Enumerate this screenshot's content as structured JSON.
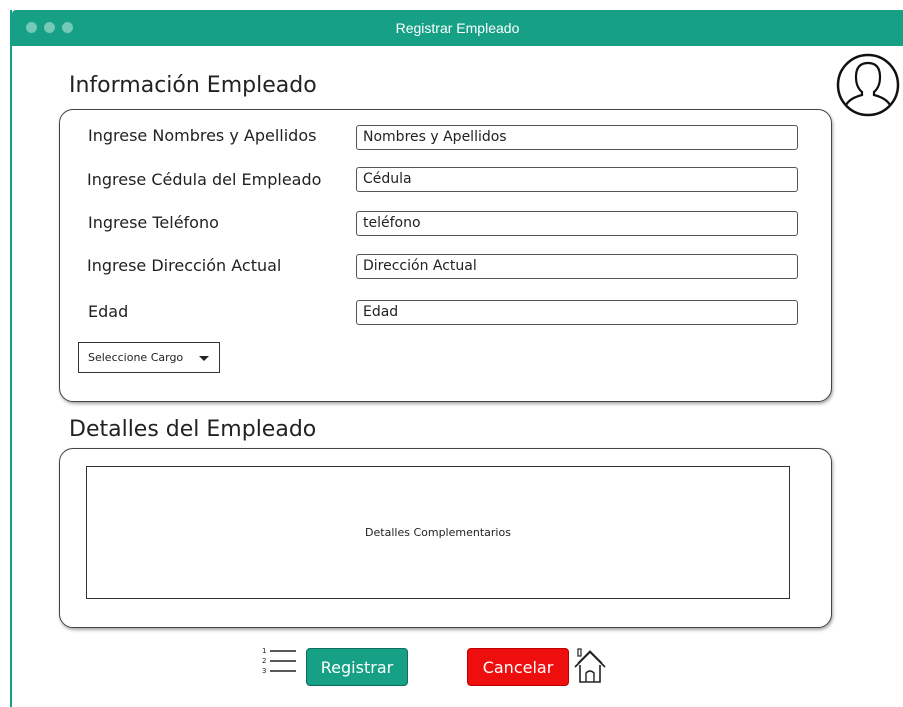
{
  "window": {
    "title": "Registrar Empleado"
  },
  "info_section": {
    "title": "Información Empleado",
    "fields": [
      {
        "label": "Ingrese Nombres y Apellidos",
        "value": "Nombres y Apellidos"
      },
      {
        "label": "Ingrese Cédula del Empleado",
        "value": "Cédula"
      },
      {
        "label": "Ingrese Teléfono",
        "value": "teléfono"
      },
      {
        "label": "Ingrese Dirección Actual",
        "value": "Dirección Actual"
      },
      {
        "label": "Edad",
        "value": "Edad"
      }
    ],
    "cargo_select": {
      "selected": "Seleccione Cargo"
    }
  },
  "details_section": {
    "title": "Detalles del Empleado",
    "textarea_text": "Detalles Complementarios"
  },
  "actions": {
    "register_label": "Registrar",
    "cancel_label": "Cancelar"
  },
  "icons": {
    "avatar": "user-avatar-icon",
    "list": "numbered-list-icon",
    "home": "home-icon"
  },
  "colors": {
    "accent": "#16a085",
    "cancel": "#ef0e0e"
  }
}
